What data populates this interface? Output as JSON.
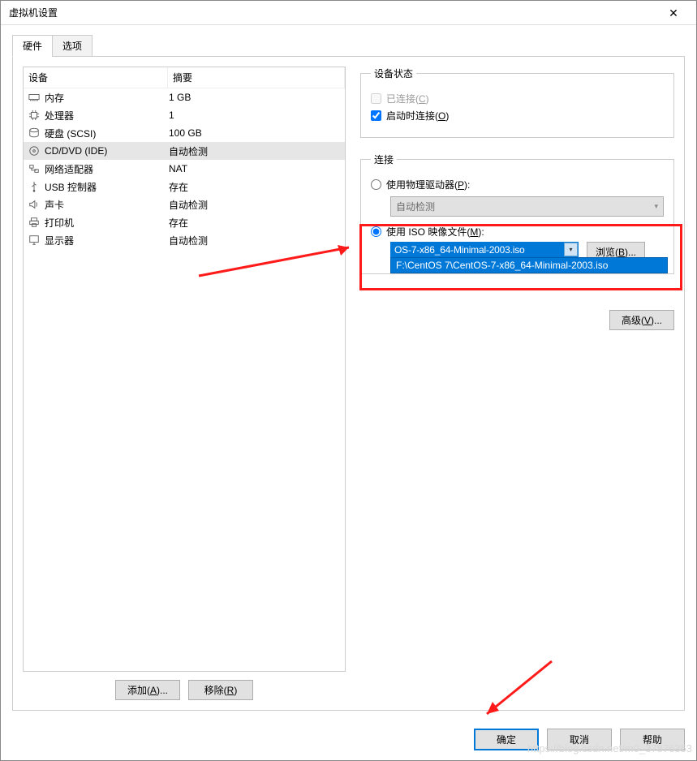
{
  "window": {
    "title": "虚拟机设置"
  },
  "tabs": {
    "hardware": "硬件",
    "options": "选项"
  },
  "device_table": {
    "header": {
      "device": "设备",
      "summary": "摘要"
    },
    "rows": [
      {
        "icon": "memory-icon",
        "name": "内存",
        "summary": "1 GB",
        "selected": false
      },
      {
        "icon": "cpu-icon",
        "name": "处理器",
        "summary": "1",
        "selected": false
      },
      {
        "icon": "disk-icon",
        "name": "硬盘 (SCSI)",
        "summary": "100 GB",
        "selected": false
      },
      {
        "icon": "disc-icon",
        "name": "CD/DVD (IDE)",
        "summary": "自动检测",
        "selected": true
      },
      {
        "icon": "net-icon",
        "name": "网络适配器",
        "summary": "NAT",
        "selected": false
      },
      {
        "icon": "usb-icon",
        "name": "USB 控制器",
        "summary": "存在",
        "selected": false
      },
      {
        "icon": "sound-icon",
        "name": "声卡",
        "summary": "自动检测",
        "selected": false
      },
      {
        "icon": "printer-icon",
        "name": "打印机",
        "summary": "存在",
        "selected": false
      },
      {
        "icon": "display-icon",
        "name": "显示器",
        "summary": "自动检测",
        "selected": false
      }
    ],
    "add_btn": "添加(A)...",
    "remove_btn": "移除(R)"
  },
  "status_group": {
    "legend": "设备状态",
    "connected": "已连接(C)",
    "connect_on_power": "启动时连接(O)"
  },
  "connect_group": {
    "legend": "连接",
    "use_physical": "使用物理驱动器(P):",
    "auto_detect": "自动检测",
    "use_iso": "使用 ISO 映像文件(M):",
    "iso_value": "OS-7-x86_64-Minimal-2003.iso",
    "iso_dropdown_item": "F:\\CentOS 7\\CentOS-7-x86_64-Minimal-2003.iso",
    "browse": "浏览(B)...",
    "advanced": "高级(V)..."
  },
  "buttons": {
    "ok": "确定",
    "cancel": "取消",
    "help": "帮助"
  },
  "watermark": "https://blog.csdn.net/m0_37876353"
}
